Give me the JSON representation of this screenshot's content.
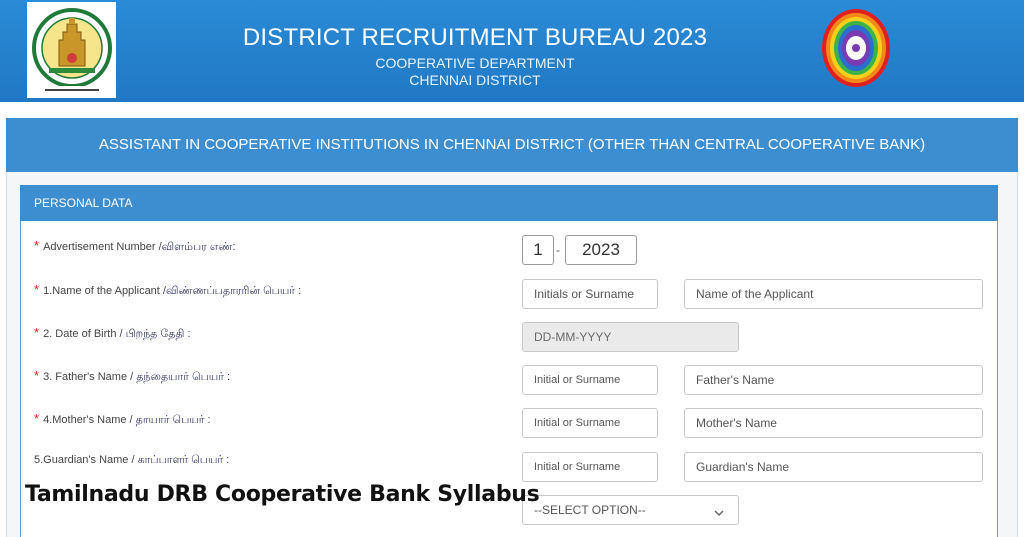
{
  "header": {
    "title": "DISTRICT RECRUITMENT BUREAU 2023",
    "subtitle1": "COOPERATIVE DEPARTMENT",
    "subtitle2": "CHENNAI DISTRICT",
    "left_logo_icon": "tamil-nadu-emblem-icon",
    "right_logo_icon": "cooperative-seal-icon"
  },
  "section": {
    "title": "ASSISTANT IN COOPERATIVE INSTITUTIONS IN CHENNAI DISTRICT (OTHER THAN CENTRAL COOPERATIVE BANK)"
  },
  "personal": {
    "title": "PERSONAL DATA",
    "fields": [
      {
        "label": "Advertisement Number /",
        "label_tamil": "விளம்பர எண்:",
        "required": "*",
        "values": [
          "1",
          "2023"
        ],
        "separator": "-"
      },
      {
        "label": "1.Name of the Applicant /",
        "label_tamil": "விண்ணப்பதாரரின் பெயர் :",
        "required": "*",
        "placeholders": [
          "Initials or Surname",
          "Name of the Applicant"
        ]
      },
      {
        "label": "2. Date of Birth /",
        "label_tamil": " பிறந்த தேதி :",
        "required": "*",
        "placeholder": "DD-MM-YYYY"
      },
      {
        "label": "3. Father's Name /",
        "label_tamil": " தந்தையார் பெயர் :",
        "required": "*",
        "placeholders": [
          "Initial or Surname",
          "Father's Name"
        ]
      },
      {
        "label": "4.Mother's Name /",
        "label_tamil": " தாயார் பெயர் :",
        "required": "*",
        "placeholders": [
          "Initial or Surname",
          "Mother's Name"
        ]
      },
      {
        "label": "5.Guardian's Name /",
        "label_tamil": " காப்பாளர் பெயர் :",
        "required": "",
        "placeholders": [
          "Initial or Surname",
          "Guardian's  Name"
        ]
      }
    ],
    "select": {
      "value": "--SELECT OPTION--",
      "icon": "chevron-down-icon"
    }
  },
  "overlay_text": "Tamilnadu DRB Cooperative Bank Syllabus",
  "colors": {
    "header_blue": "#2178c4",
    "panel_blue": "#3d8ed1",
    "required_red": "#e02020"
  }
}
